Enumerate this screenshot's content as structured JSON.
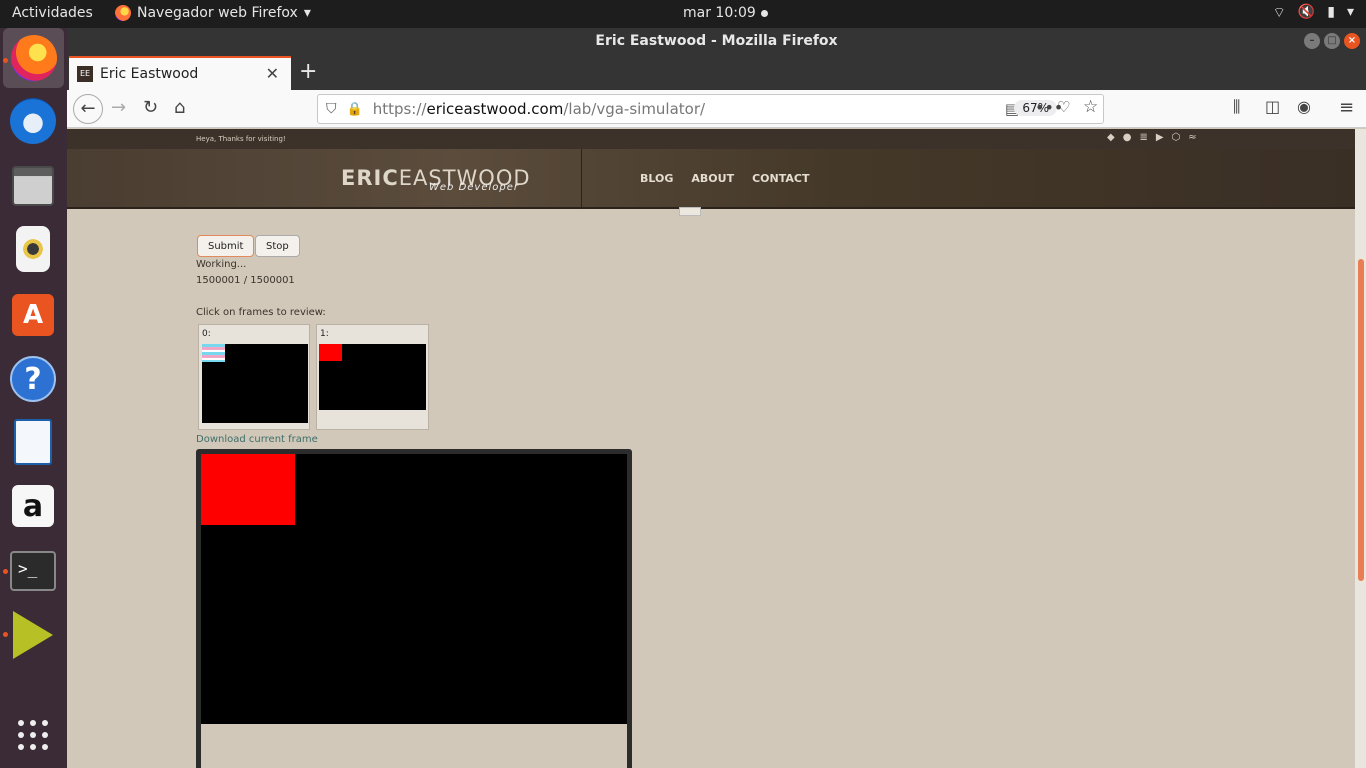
{
  "os": {
    "activities_label": "Actividades",
    "app_menu_label": "Navegador web Firefox",
    "clock": "mar 10:09",
    "tray": {
      "wifi": "wifi-icon",
      "volume": "volume-muted-icon",
      "battery": "battery-icon",
      "menu": "system-menu-icon"
    }
  },
  "dock": {
    "items": [
      {
        "name": "firefox",
        "icon": "firefox-icon",
        "running": true,
        "active": true
      },
      {
        "name": "thunderbird",
        "icon": "thunderbird-icon"
      },
      {
        "name": "files",
        "icon": "files-icon"
      },
      {
        "name": "rhythmbox",
        "icon": "rhythmbox-icon"
      },
      {
        "name": "software",
        "icon": "software-center-icon",
        "glyph": "A"
      },
      {
        "name": "help",
        "icon": "help-icon",
        "glyph": "?"
      },
      {
        "name": "writer",
        "icon": "libreoffice-writer-icon"
      },
      {
        "name": "amazon",
        "icon": "amazon-icon",
        "glyph": "a"
      },
      {
        "name": "terminal",
        "icon": "terminal-icon",
        "glyph": ">_",
        "running": true
      },
      {
        "name": "app",
        "icon": "chevron-app-icon",
        "running": true
      },
      {
        "name": "show-apps",
        "icon": "app-grid-icon"
      }
    ]
  },
  "window": {
    "title": "Eric Eastwood - Mozilla Firefox",
    "tab": {
      "title": "Eric Eastwood",
      "favicon": "EE"
    },
    "new_tab_label": "+",
    "url": {
      "prefix": "https://",
      "domain": "ericeastwood.com",
      "path": "/lab/vga-simulator/"
    },
    "zoom": "67%"
  },
  "site": {
    "greeting": "Heya, Thanks for visiting!",
    "logo": {
      "bold": "ERIC",
      "light": "EASTWOOD",
      "tagline": "Web Developer"
    },
    "nav": [
      "BLOG",
      "ABOUT",
      "CONTACT"
    ],
    "social_icons": [
      "gitlab-icon",
      "github-icon",
      "stackoverflow-icon",
      "youtube-icon",
      "codepen-icon",
      "rss-icon"
    ]
  },
  "simulator": {
    "submit_label": "Submit",
    "stop_label": "Stop",
    "status": "Working...",
    "progress": "1500001 / 1500001",
    "frames_prompt": "Click on frames to review:",
    "frames": [
      {
        "label": "0:"
      },
      {
        "label": "1:"
      }
    ],
    "download_label": "Download current frame"
  },
  "colors": {
    "accent": "#e95420",
    "page_bg": "#d1c8b9",
    "frame_red": "#ff0000",
    "link": "#3c6f6a"
  }
}
